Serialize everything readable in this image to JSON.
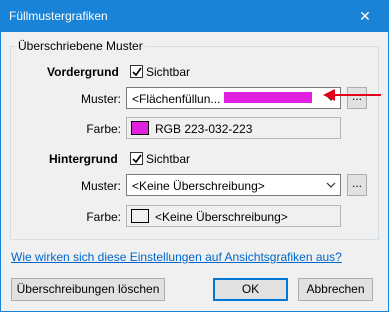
{
  "window": {
    "title": "Füllmustergrafiken",
    "close_glyph": "✕"
  },
  "group": {
    "legend": "Überschriebene Muster"
  },
  "foreground": {
    "title": "Vordergrund",
    "visible_label": "Sichtbar",
    "visible_checked": true,
    "pattern_label": "Muster:",
    "pattern_value": "<Flächenfüllun...",
    "pattern_swatch_color": "#df20df",
    "pattern_button": "...",
    "color_label": "Farbe:",
    "color_value": "RGB 223-032-223",
    "color_swatch": "#df20df"
  },
  "background": {
    "title": "Hintergrund",
    "visible_label": "Sichtbar",
    "visible_checked": true,
    "pattern_label": "Muster:",
    "pattern_value": "<Keine Überschreibung>",
    "pattern_button": "...",
    "color_label": "Farbe:",
    "color_value": "<Keine Überschreibung>",
    "color_swatch": "#f0f0f0"
  },
  "help_link": "Wie wirken sich diese Einstellungen auf Ansichtsgrafiken aus?",
  "buttons": {
    "clear": "Überschreibungen löschen",
    "ok": "OK",
    "cancel": "Abbrechen"
  },
  "colors": {
    "titlebar": "#1883d7",
    "annotation_arrow": "#e0001a",
    "link": "#0066cc"
  }
}
